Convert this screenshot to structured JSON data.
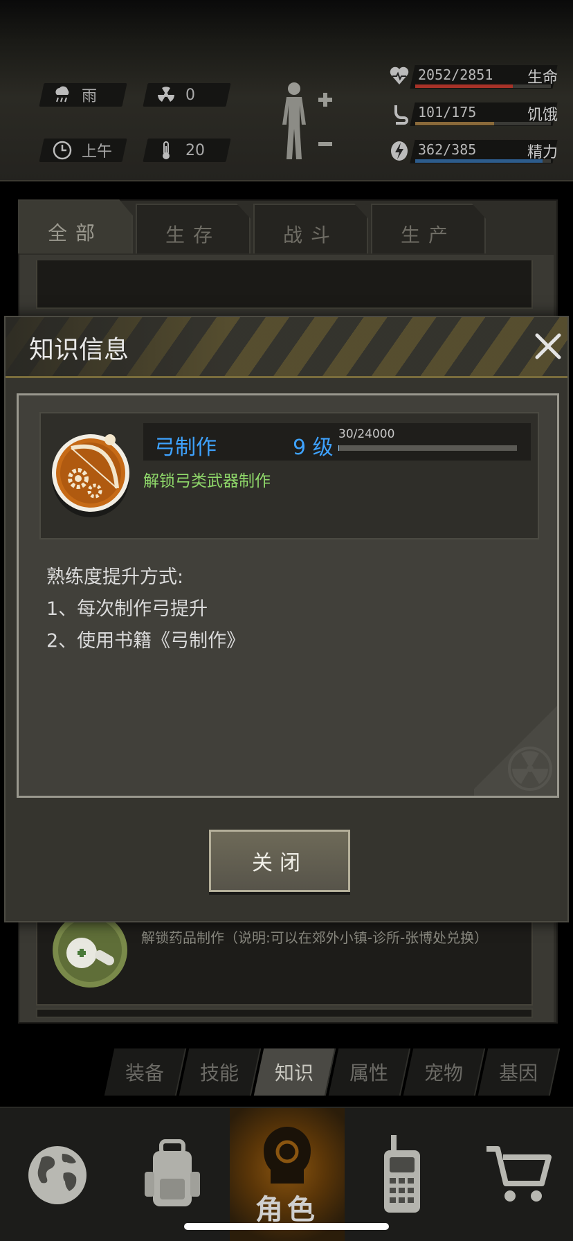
{
  "status": {
    "weather": "雨",
    "radiation": "0",
    "time_of_day": "上午",
    "temperature": "20",
    "health": {
      "value": "2052/2851",
      "label": "生命",
      "fraction": 0.72,
      "color": "#a83228"
    },
    "hunger": {
      "value": "101/175",
      "label": "饥饿",
      "fraction": 0.58,
      "color": "#8a6a3a"
    },
    "energy": {
      "value": "362/385",
      "label": "精力",
      "fraction": 0.94,
      "color": "#2d5c8c"
    }
  },
  "tabs": [
    "全部",
    "生存",
    "战斗",
    "生产"
  ],
  "active_tab": "全部",
  "background_list": {
    "bottom_item_desc": "解锁药品制作（说明:可以在郊外小镇-诊所-张博处兑换）"
  },
  "modal": {
    "title": "知识信息",
    "skill": {
      "name": "弓制作",
      "level": "9 级",
      "xp_text": "30/24000",
      "xp_fraction": 0.00125,
      "description": "解锁弓类武器制作"
    },
    "method_title": "熟练度提升方式:",
    "method_1": "1、每次制作弓提升",
    "method_2": "2、使用书籍《弓制作》",
    "close_button": "关闭"
  },
  "subtabs": [
    "装备",
    "技能",
    "知识",
    "属性",
    "宠物",
    "基因"
  ],
  "active_subtab": "知识",
  "bottom_nav": {
    "active_label": "角色",
    "items": [
      "world-icon",
      "backpack-icon",
      "character-icon",
      "radio-icon",
      "shop-cart-icon"
    ]
  }
}
